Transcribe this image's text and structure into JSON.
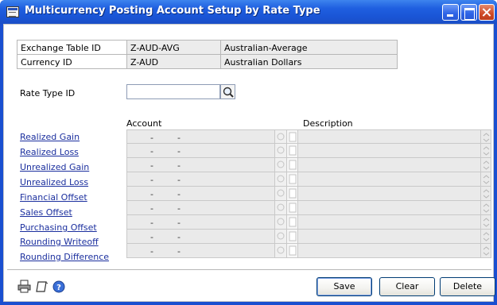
{
  "window": {
    "title": "Multicurrency Posting Account Setup by Rate Type",
    "icon": "app-window-icon"
  },
  "header": {
    "exchange_table_id": {
      "label": "Exchange Table ID",
      "value": "Z-AUD-AVG",
      "description": "Australian-Average"
    },
    "currency_id": {
      "label": "Currency ID",
      "value": "Z-AUD",
      "description": "Australian Dollars"
    }
  },
  "rate_type": {
    "label": "Rate Type ID",
    "value": ""
  },
  "columns": {
    "account": "Account",
    "description": "Description"
  },
  "rows": [
    {
      "label": "Realized Gain",
      "account": "-",
      "account2": "-",
      "description": ""
    },
    {
      "label": "Realized Loss",
      "account": "-",
      "account2": "-",
      "description": ""
    },
    {
      "label": "Unrealized Gain",
      "account": "-",
      "account2": "-",
      "description": ""
    },
    {
      "label": "Unrealized Loss",
      "account": "-",
      "account2": "-",
      "description": ""
    },
    {
      "label": "Financial Offset",
      "account": "-",
      "account2": "-",
      "description": ""
    },
    {
      "label": "Sales Offset",
      "account": "-",
      "account2": "-",
      "description": ""
    },
    {
      "label": "Purchasing Offset",
      "account": "-",
      "account2": "-",
      "description": ""
    },
    {
      "label": "Rounding Writeoff",
      "account": "-",
      "account2": "-",
      "description": ""
    },
    {
      "label": "Rounding Difference",
      "account": "-",
      "account2": "-",
      "description": ""
    }
  ],
  "buttons": {
    "save": "Save",
    "clear": "Clear",
    "delete": "Delete"
  },
  "footer_icons": [
    "printer-icon",
    "note-icon",
    "help-icon"
  ],
  "colors": {
    "titlebar": "#1f5fe0",
    "link": "#1b2f9e"
  }
}
